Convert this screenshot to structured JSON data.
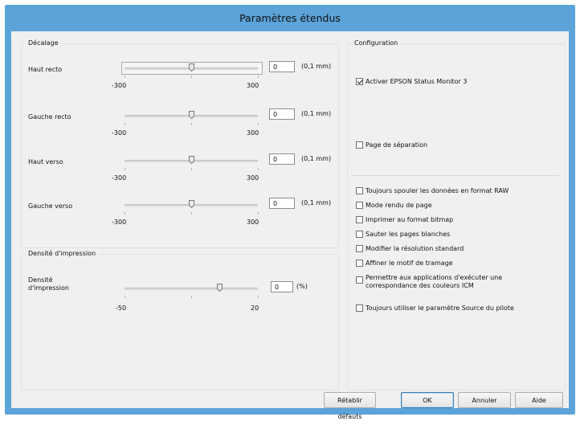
{
  "window": {
    "title": "Paramètres étendus"
  },
  "offset": {
    "group_label": "Décalage",
    "rows": [
      {
        "label": "Haut recto",
        "value": "0",
        "unit": "(0,1 mm)",
        "min": "-300",
        "max": "300",
        "level": 0.5
      },
      {
        "label": "Gauche recto",
        "value": "0",
        "unit": "(0,1 mm)",
        "min": "-300",
        "max": "300",
        "level": 0.5
      },
      {
        "label": "Haut verso",
        "value": "0",
        "unit": "(0,1 mm)",
        "min": "-300",
        "max": "300",
        "level": 0.5
      },
      {
        "label": "Gauche verso",
        "value": "0",
        "unit": "(0,1 mm)",
        "min": "-300",
        "max": "300",
        "level": 0.5
      }
    ]
  },
  "density": {
    "group_label": "Densité d'impression",
    "label_line1": "Densité",
    "label_line2": "d'impression",
    "value": "0",
    "unit": "(%)",
    "min": "-50",
    "max": "20",
    "level": 0.714
  },
  "configuration": {
    "group_label": "Configuration",
    "status_monitor": {
      "label": "Activer EPSON Status Monitor 3",
      "checked": true
    },
    "separator_page": {
      "label": "Page de séparation",
      "checked": false
    },
    "options": [
      {
        "label": "Toujours spouler les données en format RAW",
        "checked": false
      },
      {
        "label": "Mode rendu de page",
        "checked": false
      },
      {
        "label": "Imprimer au format bitmap",
        "checked": false
      },
      {
        "label": "Sauter les pages blanches",
        "checked": false
      },
      {
        "label": "Modifier la résolution standard",
        "checked": false
      },
      {
        "label": "Affiner le motif de tramage",
        "checked": false
      },
      {
        "label_line1": "Permettre aux applications d'exécuter une",
        "label_line2": "correspondance des couleurs ICM",
        "checked": false
      },
      {
        "label": "Toujours utiliser le paramètre Source du pilote",
        "checked": false
      }
    ]
  },
  "buttons": {
    "restore": "Rétablir défauts",
    "ok": "OK",
    "cancel": "Annuler",
    "help": "Aide"
  }
}
